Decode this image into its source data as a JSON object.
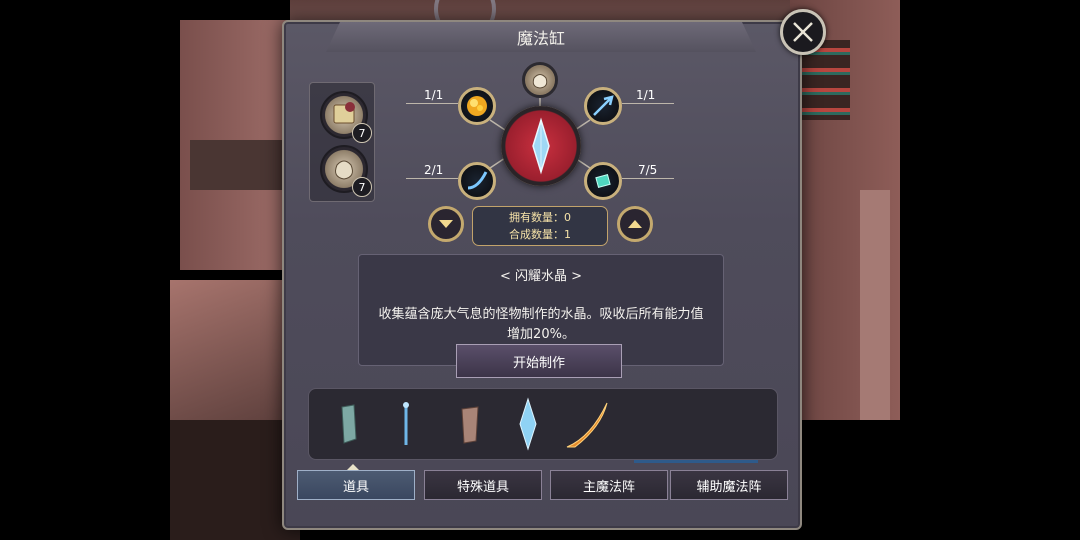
{
  "window": {
    "title": "魔法缸",
    "close_icon": "close-x-icon"
  },
  "side_stack": [
    {
      "icon": "recipe-book-icon",
      "count": "7"
    },
    {
      "icon": "pouch-icon",
      "count": "7"
    }
  ],
  "recipe": {
    "center_icon": "crystal-icon",
    "top_icon": "pouch-icon",
    "ingredients": [
      {
        "ratio": "1/1",
        "icon": "gold-ore-icon"
      },
      {
        "ratio": "1/1",
        "icon": "feather-arrow-icon"
      },
      {
        "ratio": "2/1",
        "icon": "blue-claw-icon"
      },
      {
        "ratio": "7/5",
        "icon": "teal-gem-icon"
      }
    ],
    "owned_label": "拥有数量：0",
    "craft_label": "合成数量：1"
  },
  "item": {
    "name": "< 闪耀水晶 >",
    "description": "收集蕴含庞大气息的怪物制作的水晶。吸收后所有能力值增加20%。"
  },
  "make_button": "开始制作",
  "strip_items": [
    "stone-shard-icon",
    "blue-wand-icon",
    "clay-shard-icon",
    "crystal-icon",
    "flame-sickle-icon"
  ],
  "tabs": [
    {
      "label": "道具",
      "active": true
    },
    {
      "label": "特殊道具",
      "active": false
    },
    {
      "label": "主魔法阵",
      "active": false
    },
    {
      "label": "辅助魔法阵",
      "active": false
    }
  ],
  "colors": {
    "panel": "#4f4c5b",
    "gold": "#c9b17d",
    "core": "#9b1f2e",
    "count_text": "#f6e2a8"
  }
}
